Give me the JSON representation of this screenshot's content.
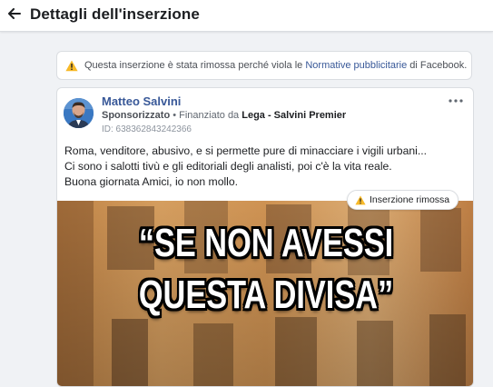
{
  "header": {
    "back_icon": "arrow-left-icon",
    "title": "Dettagli dell'inserzione"
  },
  "banner": {
    "icon": "warning-icon",
    "text_before": "Questa inserzione è stata rimossa perché viola le ",
    "link": "Normative pubblicitarie",
    "text_after": " di Facebook."
  },
  "post": {
    "author": "Matteo Salvini",
    "sponsored": "Sponsorizzato",
    "funded_prefix": " • Finanziato da ",
    "payer": "Lega - Salvini Premier",
    "ad_id": "ID: 638362843242366",
    "more_icon": "more-options-icon",
    "text_lines": [
      "Roma, venditore, abusivo, e si permette pure di minacciare i vigili urbani...",
      "Ci sono i salotti tivù e gli editoriali degli analisti, poi c'è la vita reale.",
      "Buona giornata Amici, io non mollo."
    ],
    "removed_badge": "Inserzione rimossa",
    "image_caption_line1": "“SE NON AVESSI",
    "image_caption_line2": "QUESTA DIVISA”"
  },
  "colors": {
    "link": "#385898",
    "warning": "#f7b928",
    "background": "#f0f2f5"
  }
}
